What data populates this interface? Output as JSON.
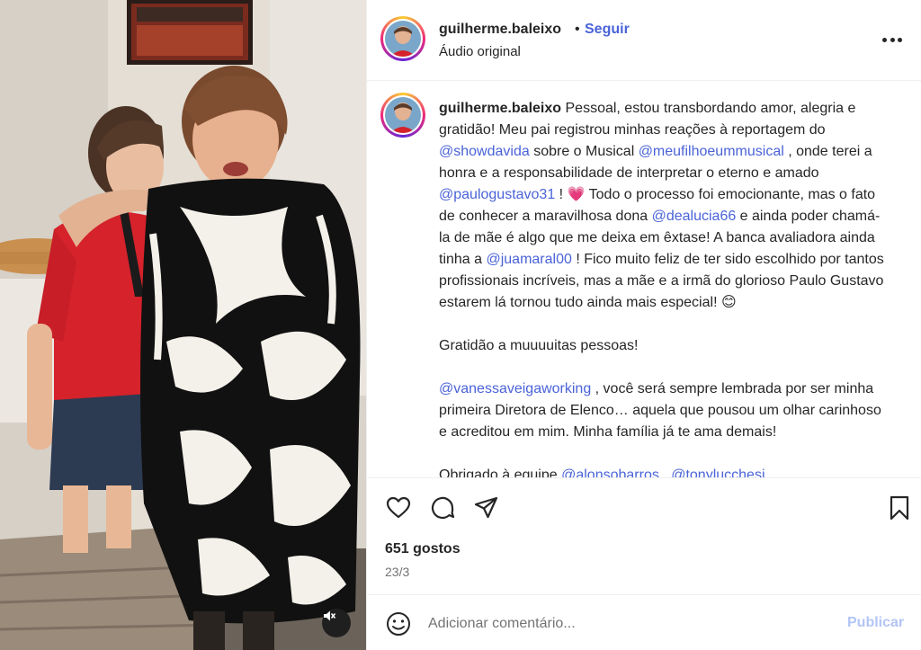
{
  "post": {
    "username": "guilherme.baleixo",
    "separator": "•",
    "follow_label": "Seguir",
    "audio_label": "Áudio original",
    "more_icon": "more-horizontal-icon"
  },
  "caption": {
    "username": "guilherme.baleixo",
    "p1_a": " Pessoal, estou transbordando amor, alegria e gratidão! Meu pai registrou minhas reações à reportagem do ",
    "m_showdavida": "@showdavida",
    "p1_b": " sobre o Musical ",
    "m_meufilho": "@meufilhoeummusical",
    "p1_c": " , onde terei a honra e a responsabilidade de interpretar o eterno e amado ",
    "m_paulo": "@paulogustavo31",
    "p1_d": " ! ",
    "heart_emoji": "💗",
    "p1_e": " Todo o processo foi emocionante, mas o fato de conhecer a maravilhosa dona ",
    "m_dealucia": "@dealucia66",
    "p1_f": " e ainda poder chamá-la de mãe é algo que me deixa em êxtase! A banca avaliadora ainda tinha a ",
    "m_juamaral": "@juamaral00",
    "p1_g": " ! Fico muito feliz de ter sido escolhido por tantos profissionais incríveis, mas a mãe e a irmã do glorioso Paulo Gustavo estarem lá tornou tudo ainda mais especial! ",
    "smile_emoji": "😊",
    "p2": "Gratidão a muuuuitas pessoas!",
    "m_vanessa": "@vanessaveigaworking",
    "p3": " , você será sempre lembrada por ser minha primeira Diretora de Elenco… aquela que pousou um olhar carinhoso e acreditou em mim. Minha família já te ama demais!",
    "p4_a": "Obrigado à equipe ",
    "m_alonso": "@alonsobarros",
    "p4_b": " , ",
    "m_tony": "@tonylucchesi",
    "p4_c": " ,"
  },
  "actions": {
    "like_icon": "heart-icon",
    "comment_icon": "comment-icon",
    "share_icon": "share-icon",
    "save_icon": "bookmark-icon",
    "likes_text": "651 gostos",
    "date_text": "23/3"
  },
  "comment_box": {
    "emoji_icon": "emoji-icon",
    "placeholder": "Adicionar comentário...",
    "publish_label": "Publicar"
  },
  "media": {
    "mute_icon": "muted-speaker-icon"
  },
  "colors": {
    "link": "#4a63d8",
    "publish_disabled": "#b3c5f5",
    "text": "#262626",
    "secondary": "#737373"
  }
}
